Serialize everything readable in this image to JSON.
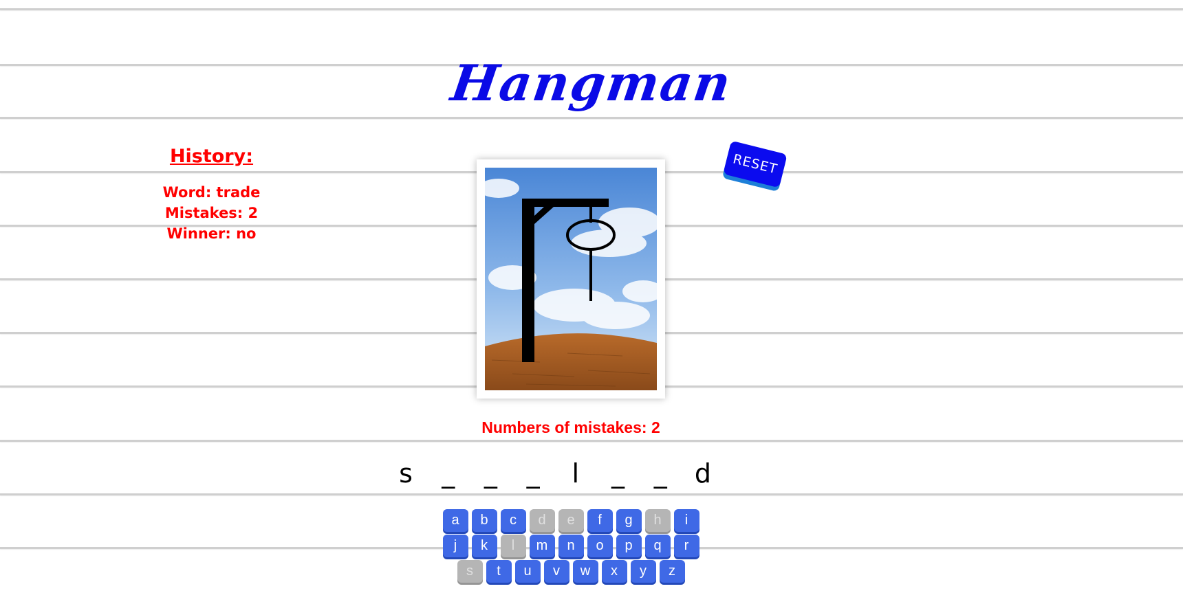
{
  "title": "Hangman",
  "history": {
    "heading": "History:",
    "entries": [
      "Word: trade",
      "Mistakes: 2",
      "Winner: no"
    ]
  },
  "reset_label": "RESET",
  "mistakes_text": "Numbers of mistakes: 2",
  "mistakes_count": 2,
  "word_slots": [
    "s",
    "_",
    "_",
    "_",
    "l",
    "_",
    "_",
    "d"
  ],
  "keyboard": {
    "rows": [
      [
        "a",
        "b",
        "c",
        "d",
        "e",
        "f",
        "g",
        "h",
        "i"
      ],
      [
        "j",
        "k",
        "l",
        "m",
        "n",
        "o",
        "p",
        "q",
        "r"
      ],
      [
        "s",
        "t",
        "u",
        "v",
        "w",
        "x",
        "y",
        "z"
      ]
    ],
    "used_letters": [
      "d",
      "e",
      "h",
      "l",
      "s"
    ]
  },
  "colors": {
    "title": "#0a0ae6",
    "accent_red": "#ff0000",
    "reset_button": "#0b0bef",
    "key_active": "#3f69e6",
    "key_used": "#b5b5b5"
  }
}
